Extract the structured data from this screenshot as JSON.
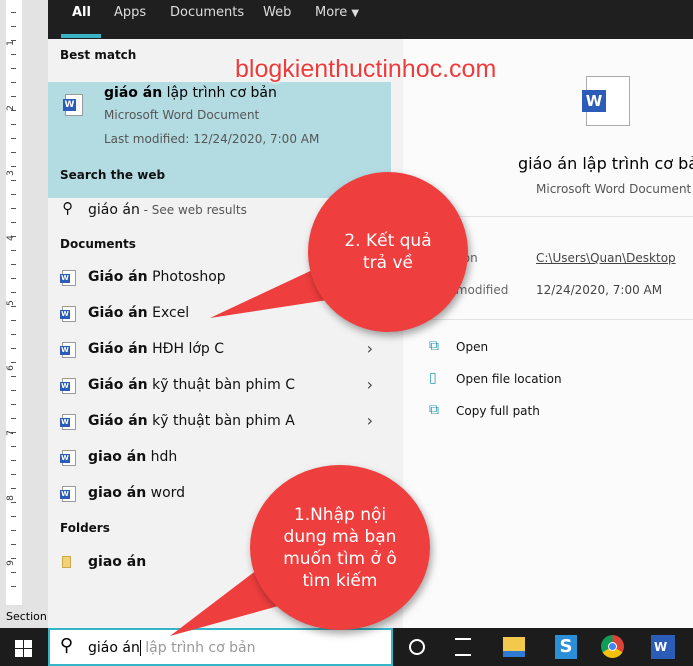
{
  "watermark": "blogkienthuctinhoc.com",
  "ruler": {
    "numbers": [
      "1",
      "2",
      "3",
      "4",
      "5",
      "6",
      "7",
      "8",
      "9"
    ]
  },
  "status_bar": {
    "section": "Section:"
  },
  "tabs": [
    "All",
    "Apps",
    "Documents",
    "Web",
    "More"
  ],
  "best_match": {
    "heading": "Best match",
    "title_bold": "giáo án",
    "title_rest": " lập trình cơ bản",
    "type": "Microsoft Word Document",
    "modified": "Last modified: 12/24/2020, 7:00 AM"
  },
  "web": {
    "heading": "Search the web",
    "query": "giáo án",
    "suffix": " - See web results"
  },
  "documents": {
    "heading": "Documents",
    "items": [
      {
        "bold": "Giáo án",
        "rest": " Photoshop",
        "chevron": false
      },
      {
        "bold": "Giáo án",
        "rest": " Excel",
        "chevron": true
      },
      {
        "bold": "Giáo án",
        "rest": " HĐH lớp C",
        "chevron": true
      },
      {
        "bold": "Giáo án",
        "rest": " kỹ thuật bàn phim C",
        "chevron": true
      },
      {
        "bold": "Giáo án",
        "rest": " kỹ thuật bàn phim A",
        "chevron": true
      },
      {
        "bold": "giao án",
        "rest": " hdh",
        "chevron": false
      },
      {
        "bold": "giao án",
        "rest": " word",
        "chevron": false
      }
    ]
  },
  "folders": {
    "heading": "Folders",
    "items": [
      {
        "bold": "giao án",
        "rest": ""
      }
    ]
  },
  "preview": {
    "title": "giáo án lập trình cơ bản",
    "type": "Microsoft Word Document",
    "location_label": "Location",
    "location": "C:\\Users\\Quan\\Desktop",
    "modified_label": "Last modified",
    "modified": "12/24/2020, 7:00 AM",
    "actions": [
      "Open",
      "Open file location",
      "Copy full path"
    ]
  },
  "search": {
    "typed": "giáo án",
    "suggestion": " lập trình cơ bản"
  },
  "callouts": {
    "result": "2. Kết quả trả về",
    "input": "1.Nhập nội dung mà bạn muốn tìm ở ô tìm kiếm"
  },
  "colors": {
    "accent": "#39b3c6",
    "highlight": "#b3dce2",
    "callout": "#ef3e3e"
  }
}
